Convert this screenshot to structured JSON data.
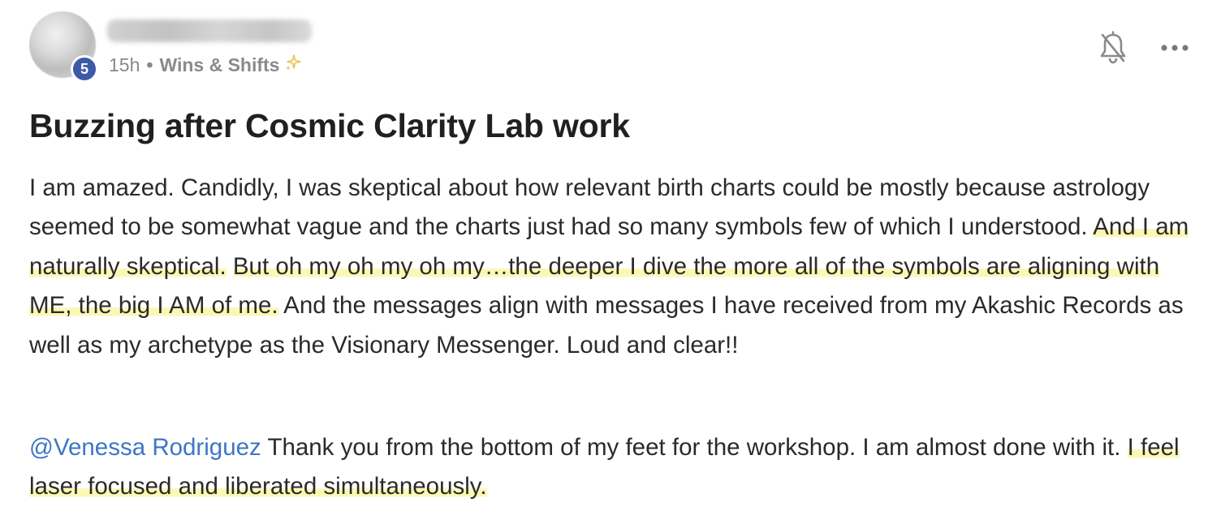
{
  "post": {
    "author": {
      "level": "5",
      "avatar_icon": "blurred-avatar"
    },
    "meta": {
      "time": "15h",
      "separator": "•",
      "category": "Wins & Shifts",
      "category_icon": "sparkle-icon"
    },
    "actions": {
      "notifications_icon": "bell-off-icon",
      "more_icon": "ellipsis-icon"
    },
    "title": "Buzzing after Cosmic Clarity Lab work",
    "paragraph1": {
      "s1": "I am amazed. Candidly, I was skeptical about how relevant birth charts could be mostly because astrology seemed to be somewhat vague and the charts just had so many symbols few of which I understood. ",
      "s2": "And I am naturally skeptical.",
      "s3": " ",
      "s4": "But oh my oh my oh my…the deeper I dive the more all of the symbols are aligning with ME, the big I AM of me.",
      "s5": " And the messages align with messages I have received from my Akashic Records as well as my archetype as the Visionary Messenger. Loud and clear!!"
    },
    "paragraph2": {
      "mention": "@Venessa Rodriguez",
      "s1": " Thank you from the bottom of my feet for the workshop. I am almost done with it. ",
      "s2": "I feel laser focused and liberated simultaneously."
    },
    "colors": {
      "badge": "#3d5aa8",
      "mention": "#3e76c6",
      "highlight": "#fbf8b6",
      "sparkle": "#e9c44a"
    }
  }
}
